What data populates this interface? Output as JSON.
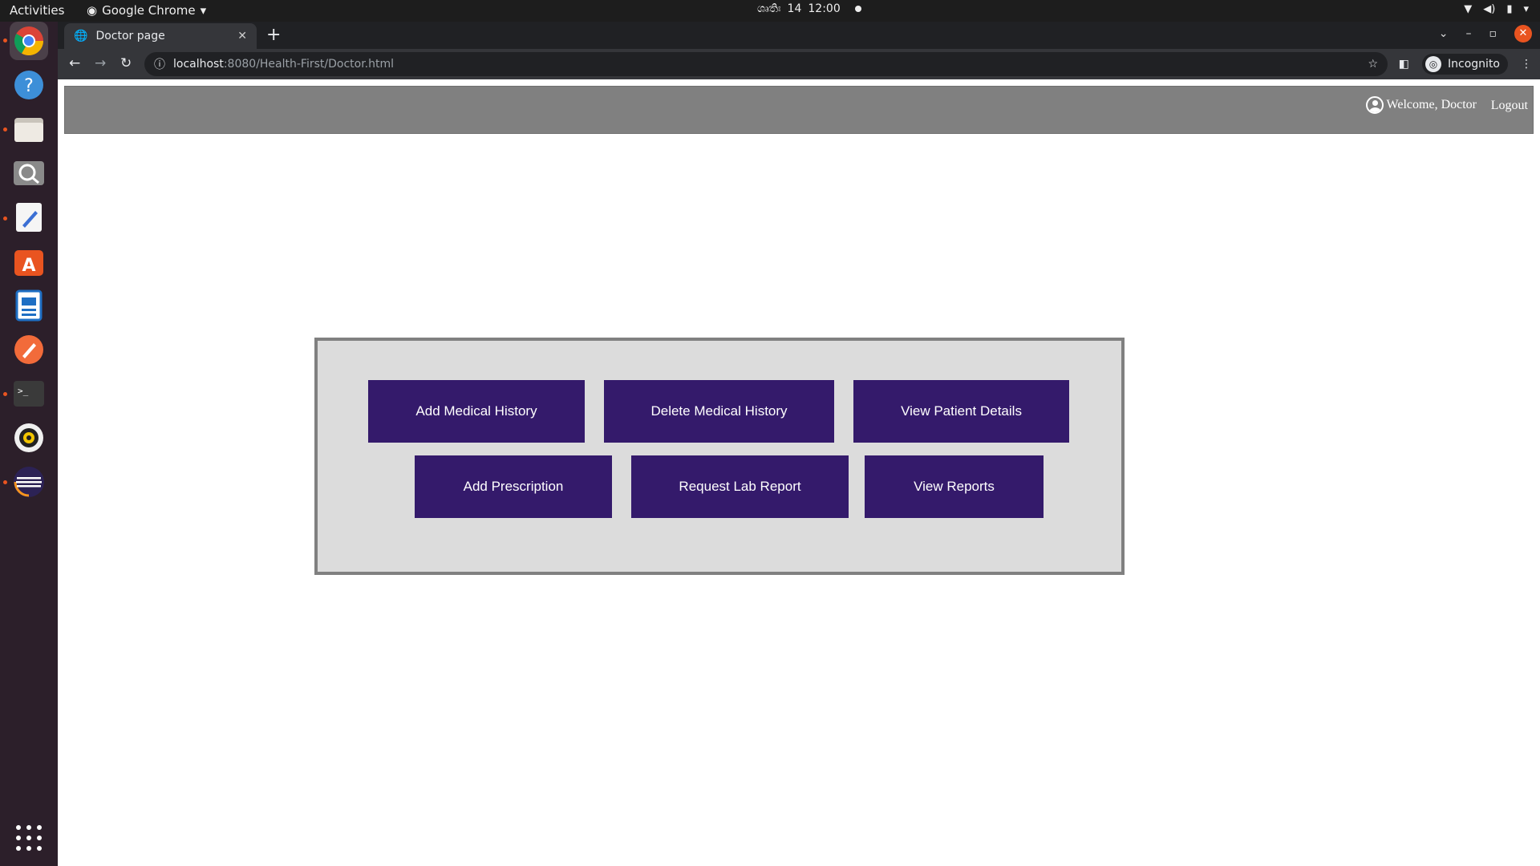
{
  "system": {
    "activities": "Activities",
    "app_menu": "Google Chrome",
    "date": "ශ්‍රුතිඃ",
    "day": "14",
    "time": "12:00"
  },
  "browser": {
    "tab_title": "Doctor page",
    "url_host": "localhost",
    "url_rest": ":8080/Health-First/Doctor.html",
    "incognito_label": "Incognito"
  },
  "header": {
    "welcome": "Welcome, Doctor",
    "logout": "Logout",
    "background": "#808080"
  },
  "actions": {
    "row1": [
      "Add Medical History",
      "Delete Medical History",
      "View Patient Details"
    ],
    "row2": [
      "Add Prescription",
      "Request Lab Report",
      "View Reports"
    ],
    "button_color": "#341a6b"
  },
  "dock": {
    "apps": [
      "chrome-icon",
      "help-icon",
      "files-icon",
      "search-icon",
      "text-editor-icon",
      "software-icon",
      "writer-icon",
      "inkscape-icon",
      "terminal-icon",
      "rhythmbox-icon",
      "eclipse-icon",
      "show-apps-icon"
    ]
  }
}
